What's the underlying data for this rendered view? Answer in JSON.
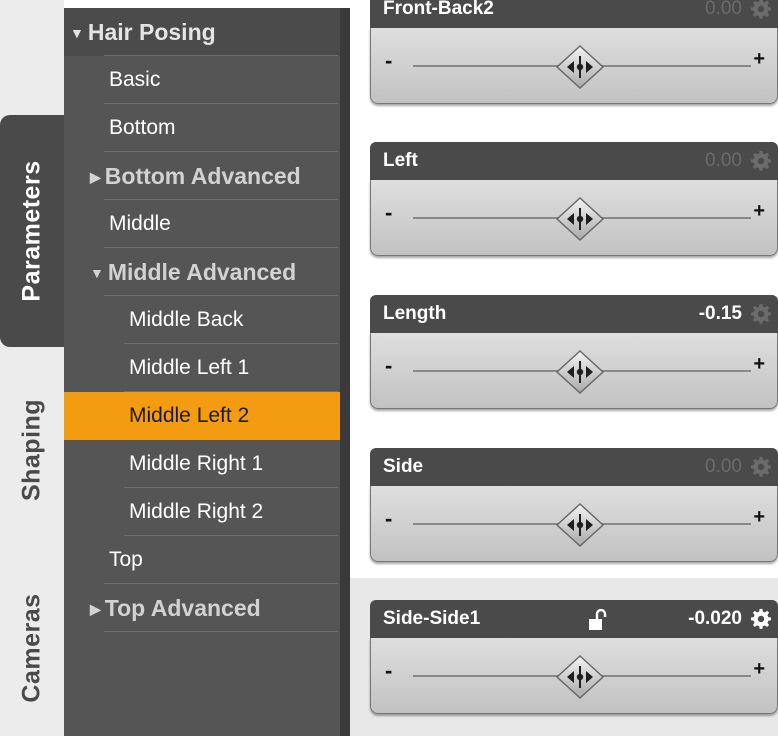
{
  "tabs": [
    {
      "label": "Parameters",
      "active": true
    },
    {
      "label": "Shaping",
      "active": false
    },
    {
      "label": "Cameras",
      "active": false
    }
  ],
  "tree": {
    "header": {
      "label": "Hair Posing",
      "expanded": true
    },
    "items": [
      {
        "label": "Basic",
        "kind": "leaf",
        "level": 1
      },
      {
        "label": "Bottom",
        "kind": "leaf",
        "level": 1
      },
      {
        "label": "Bottom Advanced",
        "kind": "group",
        "expanded": false,
        "level": 1
      },
      {
        "label": "Middle",
        "kind": "leaf",
        "level": 1
      },
      {
        "label": "Middle Advanced",
        "kind": "group",
        "expanded": true,
        "level": 1
      },
      {
        "label": "Middle Back",
        "kind": "leaf",
        "level": 2
      },
      {
        "label": "Middle Left 1",
        "kind": "leaf",
        "level": 2
      },
      {
        "label": "Middle Left 2",
        "kind": "leaf",
        "level": 2,
        "selected": true
      },
      {
        "label": "Middle Right 1",
        "kind": "leaf",
        "level": 2
      },
      {
        "label": "Middle Right 2",
        "kind": "leaf",
        "level": 2
      },
      {
        "label": "Top",
        "kind": "leaf",
        "level": 1
      },
      {
        "label": "Top Advanced",
        "kind": "group",
        "expanded": false,
        "level": 1
      }
    ]
  },
  "sliders": [
    {
      "name": "Front-Back2",
      "value": "0.00",
      "modified": false,
      "position": 0.5
    },
    {
      "name": "Left",
      "value": "0.00",
      "modified": false,
      "position": 0.5
    },
    {
      "name": "Length",
      "value": "-0.15",
      "modified": true,
      "position": 0.5
    },
    {
      "name": "Side",
      "value": "0.00",
      "modified": false,
      "position": 0.5
    },
    {
      "name": "Side-Side1",
      "value": "-0.020",
      "modified": true,
      "position": 0.5,
      "locked": false
    }
  ],
  "labels": {
    "minus": "-",
    "plus": "+"
  },
  "colors": {
    "selection": "#f39c12",
    "panel": "#555555",
    "header": "#4a4a4a"
  }
}
